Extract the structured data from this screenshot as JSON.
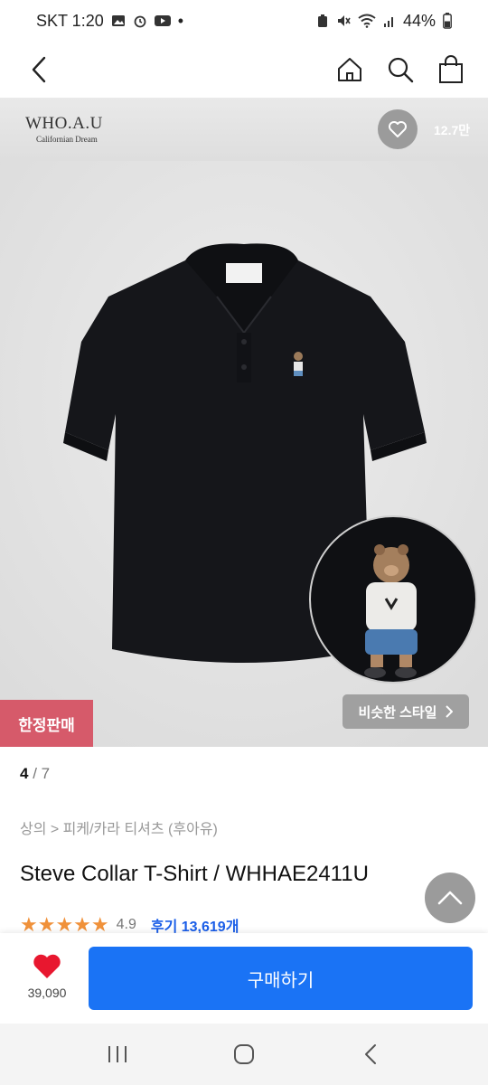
{
  "status_bar": {
    "carrier_time": "SKT 1:20",
    "dot": "•",
    "battery": "44%"
  },
  "brand": {
    "name": "WHO.A.U",
    "tagline": "Californian Dream"
  },
  "likes_header": "12.7만",
  "badge": "한정판매",
  "similar_style": "비슷한 스타일",
  "pager": {
    "current": "4",
    "total": "/ 7"
  },
  "breadcrumb": "상의 > 피케/카라 티셔츠 (후아유)",
  "product_title": "Steve Collar T-Shirt / WHHAE2411U",
  "rating": {
    "stars": "★★★★★",
    "value": "4.9",
    "reviews": "후기 13,619개"
  },
  "wish_count": "39,090",
  "buy_label": "구매하기",
  "icons": [
    "back-icon",
    "home-icon",
    "search-icon",
    "cart-icon",
    "heart-icon",
    "chevron-up-icon",
    "recent-apps-icon",
    "home-button-icon",
    "back-button-icon"
  ],
  "colors": {
    "accent": "#1a73f5",
    "badge": "#d65a6a",
    "star": "#f0913a",
    "heart": "#e8172f"
  }
}
